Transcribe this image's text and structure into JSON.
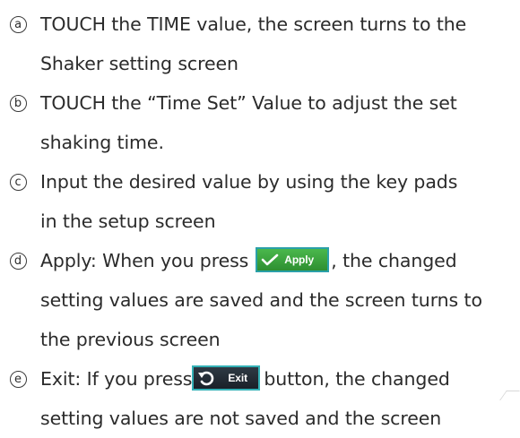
{
  "items": [
    {
      "marker": "a",
      "lines": [
        "TOUCH the TIME value, the screen turns to the",
        "Shaker setting screen"
      ]
    },
    {
      "marker": "b",
      "lines": [
        "TOUCH the “Time Set” Value to adjust the set",
        "shaking time."
      ]
    },
    {
      "marker": "c",
      "lines": [
        "Input the desired value by using the key pads",
        "in the setup screen"
      ]
    },
    {
      "marker": "d",
      "line1_before": "Apply: When you press",
      "line1_after": ", the changed",
      "lines_rest": [
        "setting values are saved and the screen turns to",
        "the previous screen"
      ],
      "button_label": "Apply",
      "button_icon": "checkmark-icon"
    },
    {
      "marker": "e",
      "line1_before": "Exit: If you press",
      "line1_after": "button, the changed",
      "lines_rest": [
        "setting values are not saved and the screen"
      ],
      "button_label": "Exit",
      "button_icon": "undo-arrow-icon"
    }
  ],
  "colors": {
    "apply_button": "#3aa43d",
    "exit_button": "#222a32",
    "button_border": "#2aa0a8"
  }
}
